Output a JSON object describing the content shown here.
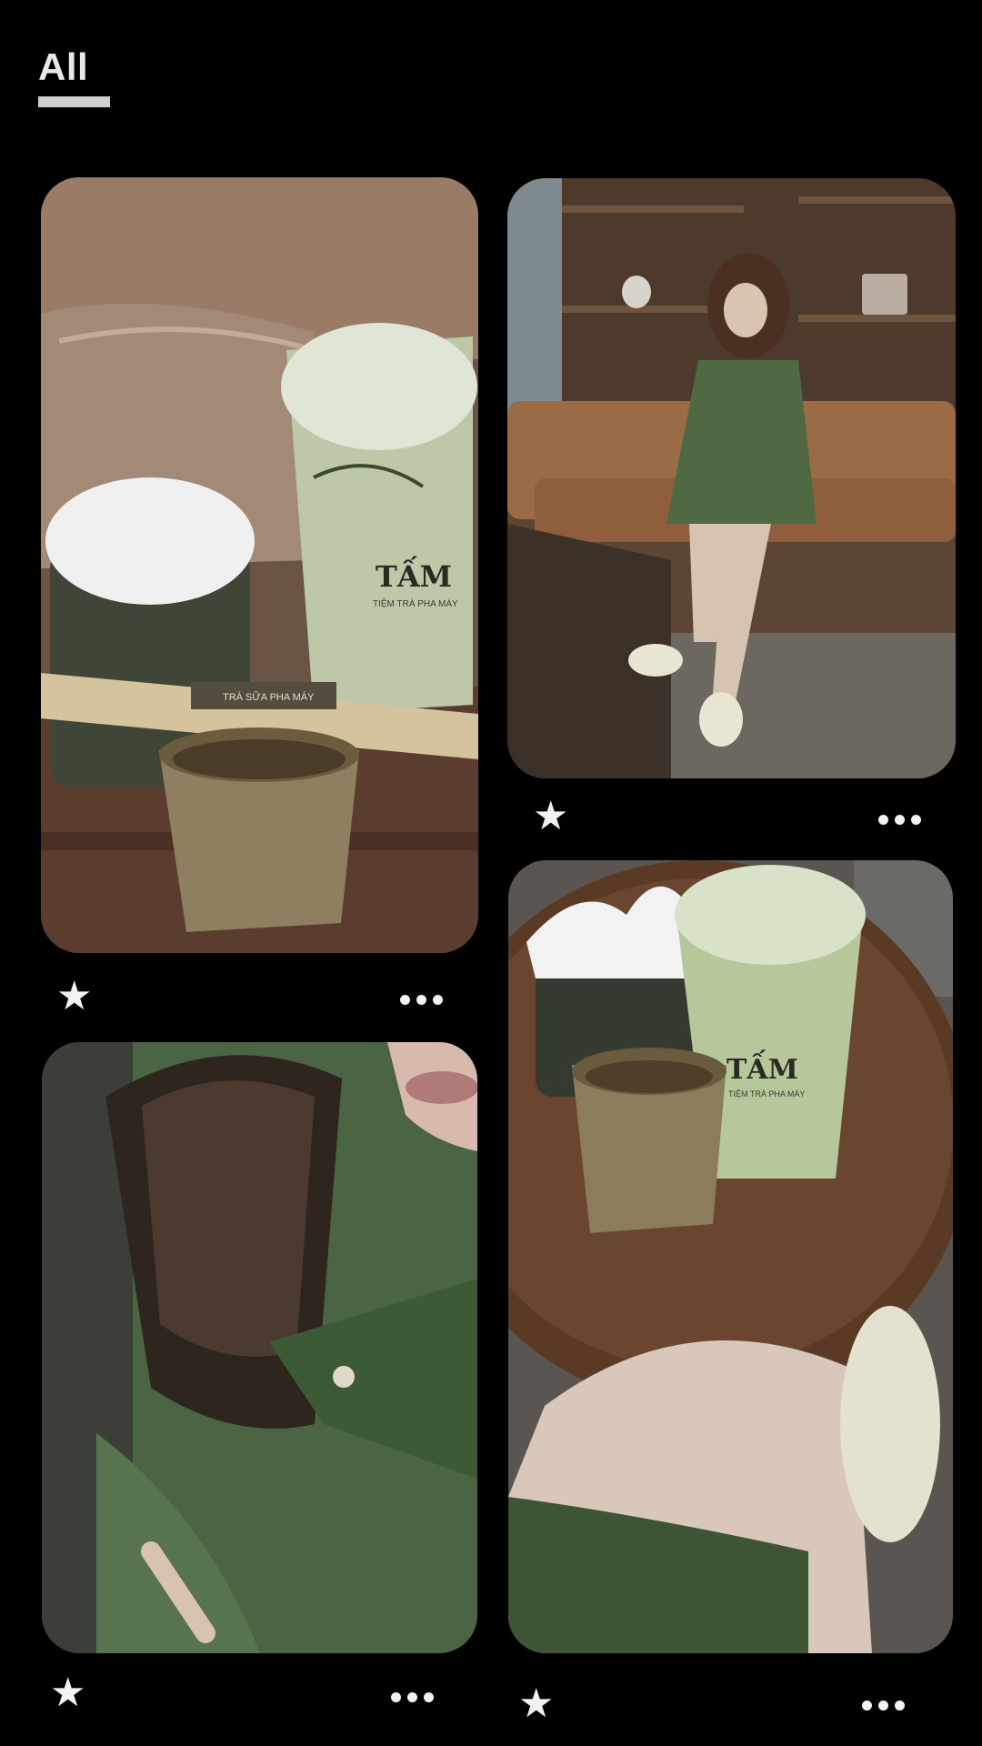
{
  "header": {
    "tab_label": "All"
  },
  "posts": [
    {
      "id": "post-1",
      "brand_logo": "TẤM",
      "brand_tagline": "TIỆM TRÀ PHA MÁY",
      "straw_label": "TRÀ SỮA PHA MÁY"
    },
    {
      "id": "post-2"
    },
    {
      "id": "post-3"
    },
    {
      "id": "post-4",
      "brand_logo": "TẤM",
      "brand_tagline": "TIỆM TRÀ PHA MÁY"
    }
  ],
  "icons": {
    "favorite": "star-icon",
    "more": "more-options-icon"
  },
  "colors": {
    "background": "#000000",
    "icon": "#f2f2f2",
    "tab_underline": "#cfcfcf"
  }
}
